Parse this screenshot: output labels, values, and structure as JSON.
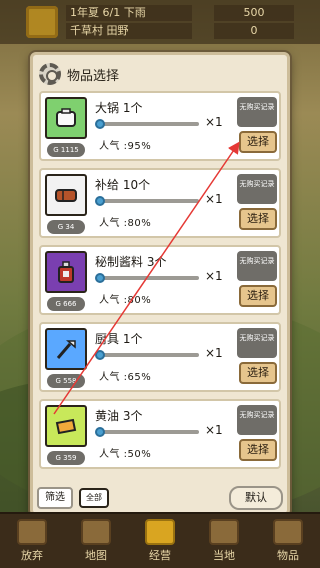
{
  "background": {
    "date": "1年夏 6/1 下雨",
    "location": "千草村 田野",
    "gold": "500",
    "counter": "0"
  },
  "dialog": {
    "title": "物品选择",
    "items": [
      {
        "name": "大锅 1个",
        "price": "G 1115",
        "qty": "×1",
        "popularity": "人气 :95%",
        "no_record": "无购买记录",
        "select_label": "选择",
        "thumb_color": "#7fd06f",
        "icon": "pot-icon"
      },
      {
        "name": "补给 10个",
        "price": "G 34",
        "qty": "×1",
        "popularity": "人气 :80%",
        "no_record": "无购买记录",
        "select_label": "选择",
        "thumb_color": "#f2f2f2",
        "icon": "supply-icon"
      },
      {
        "name": "秘制酱料 3个",
        "price": "G 666",
        "qty": "×1",
        "popularity": "人气 :80%",
        "no_record": "无购买记录",
        "select_label": "选择",
        "thumb_color": "#7a3fb0",
        "icon": "sauce-bottle-icon"
      },
      {
        "name": "厨具 1个",
        "price": "G 558",
        "qty": "×1",
        "popularity": "人气 :65%",
        "no_record": "无购买记录",
        "select_label": "选择",
        "thumb_color": "#5aa8ff",
        "icon": "utensil-icon"
      },
      {
        "name": "黄油 3个",
        "price": "G 359",
        "qty": "×1",
        "popularity": "人气 :50%",
        "no_record": "无购买记录",
        "select_label": "选择",
        "thumb_color": "#c8e85a",
        "icon": "butter-icon"
      }
    ],
    "footer": {
      "filter_label": "筛选",
      "all_label": "全部",
      "default_label": "默认"
    }
  },
  "bottom_nav": [
    {
      "label": "放弃",
      "icon": "undo-icon"
    },
    {
      "label": "地图",
      "icon": "map-icon"
    },
    {
      "label": "经营",
      "icon": "coin-stack-icon"
    },
    {
      "label": "当地",
      "icon": "lock-icon"
    },
    {
      "label": "物品",
      "icon": "bag-icon"
    }
  ]
}
